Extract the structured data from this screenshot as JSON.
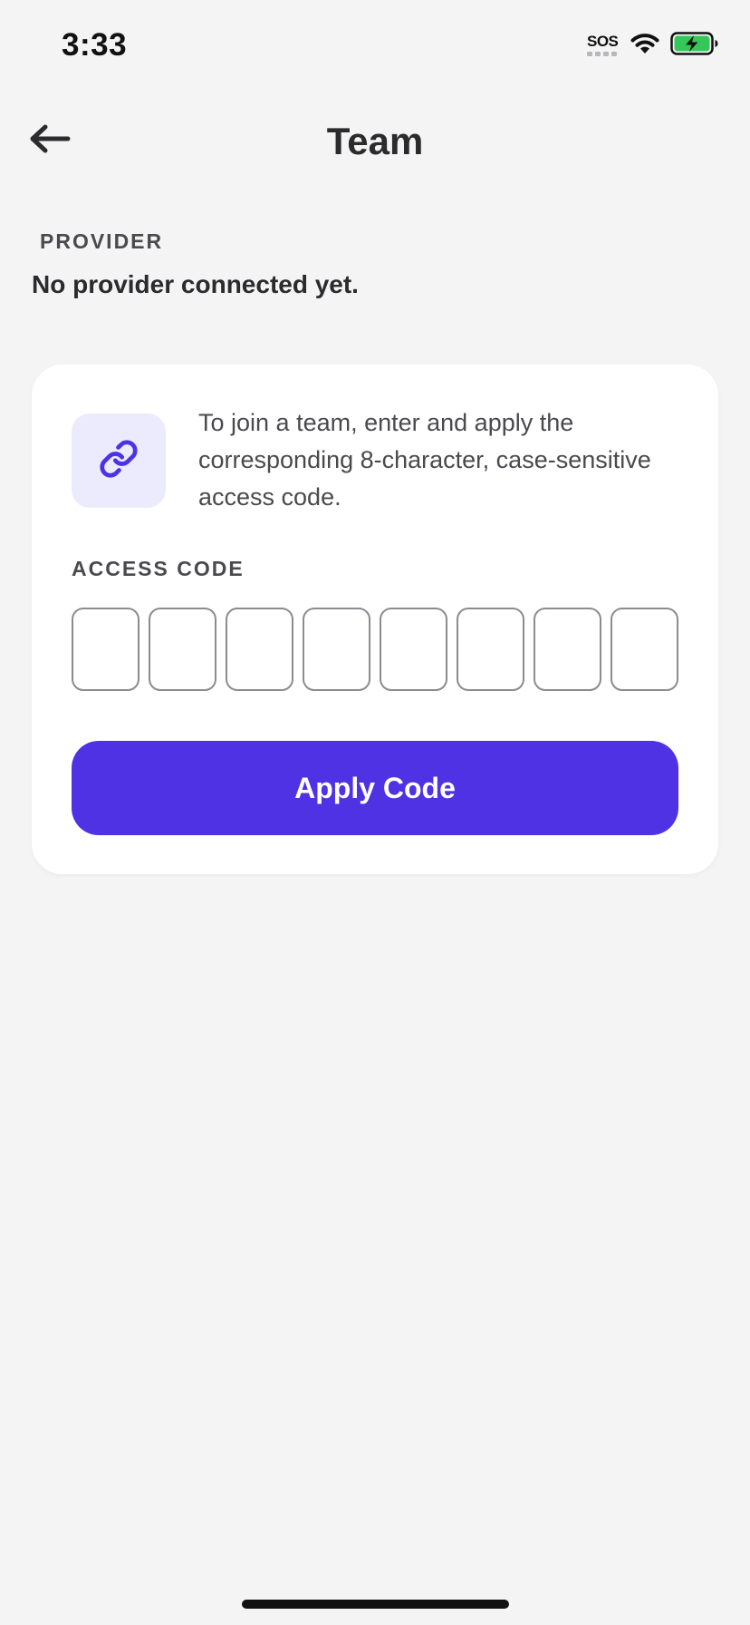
{
  "status_bar": {
    "time": "3:33",
    "sos": "SOS",
    "icons": [
      "wifi-icon",
      "battery-charging-icon"
    ],
    "battery_color": "#34c759"
  },
  "header": {
    "title": "Team",
    "back_icon": "arrow-left-icon"
  },
  "provider": {
    "label": "PROVIDER",
    "value": "No provider connected yet."
  },
  "card": {
    "icon": "link-icon",
    "description": "To join a team, enter and apply the corresponding 8-character, case-sensitive access code.",
    "access_code_label": "ACCESS CODE",
    "code_values": [
      "",
      "",
      "",
      "",
      "",
      "",
      "",
      ""
    ],
    "apply_label": "Apply Code"
  },
  "colors": {
    "accent": "#4f32e3",
    "icon_tile_bg": "#ecebfd",
    "background": "#f4f4f5"
  }
}
